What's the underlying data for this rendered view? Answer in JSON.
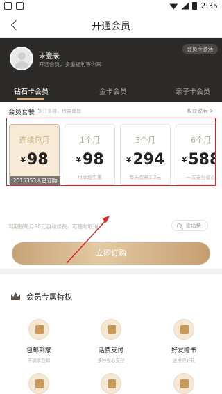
{
  "status_bar": {
    "time": "2:35"
  },
  "header": {
    "title": "开通会员"
  },
  "user": {
    "name": "未登录",
    "subtitle": "开通会员，多重福利等你来",
    "activate_label": "会员卡激活"
  },
  "tabs": [
    {
      "label": "钻石卡会员",
      "active": true
    },
    {
      "label": "金卡会员",
      "active": false
    },
    {
      "label": "亲子卡会员",
      "active": false
    }
  ],
  "plans_section": {
    "title": "会员套餐",
    "subtitle": "多订多得，权益叠加",
    "rules_link": "权益说明 >"
  },
  "plans": [
    {
      "name": "连续包月",
      "currency": "¥",
      "price": "98",
      "note": "",
      "active": true,
      "badge": "2015353人已订购"
    },
    {
      "name": "1个月",
      "currency": "¥",
      "price": "98",
      "note": "月享超实惠",
      "active": false
    },
    {
      "name": "3个月",
      "currency": "¥",
      "price": "294",
      "note": "每天仅需3.2元",
      "active": false
    },
    {
      "name": "6个月",
      "currency": "¥",
      "price": "588",
      "note": "一次支付省心",
      "active": false
    }
  ],
  "auto_renew_text": "到期按每月98元自动续费，可随时取消",
  "check_button_label": "查话费",
  "buy_button_label": "立即订购",
  "privileges": {
    "title": "会员专属特权",
    "items": [
      {
        "label": "包邮到家",
        "sub": "不满享包邮",
        "icon": "parcel-icon"
      },
      {
        "label": "话费支付",
        "sub": "多种省心支付",
        "icon": "phone-pay-icon"
      },
      {
        "label": "好友赠书",
        "sub": "送书得好礼",
        "icon": "gift-book-icon"
      }
    ]
  },
  "colors": {
    "accent": "#d8b27a",
    "hero_bg": "#2c2b2a",
    "highlight_frame": "#d8262a"
  }
}
